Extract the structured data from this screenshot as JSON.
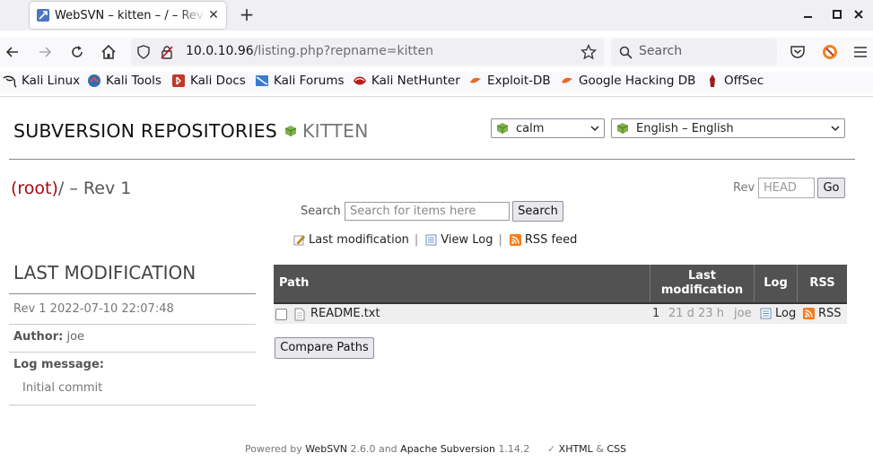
{
  "browser": {
    "tab_title": "WebSVN – kitten – / – Rev 1",
    "url_host": "10.0.10.96",
    "url_path": "/listing.php?repname=kitten",
    "search_placeholder": "Search",
    "bookmarks": [
      "Kali Linux",
      "Kali Tools",
      "Kali Docs",
      "Kali Forums",
      "Kali NetHunter",
      "Exploit-DB",
      "Google Hacking DB",
      "OffSec"
    ]
  },
  "header": {
    "title": "SUBVERSION REPOSITORIES",
    "repo": "KITTEN",
    "template_select": "calm",
    "language_select": "English – English"
  },
  "path_bar": {
    "root": "(root)",
    "path_suffix": "/ – Rev 1",
    "rev_label": "Rev",
    "rev_placeholder": "HEAD",
    "go_label": "Go"
  },
  "search": {
    "label": "Search",
    "placeholder": "Search for items here",
    "button": "Search"
  },
  "actions": {
    "last_modification": "Last modification",
    "view_log": "View Log",
    "rss_feed": "RSS feed",
    "separator": "|"
  },
  "last_mod": {
    "heading": "LAST MODIFICATION",
    "rev_line": "Rev 1 2022-07-10 22:07:48",
    "author_label": "Author:",
    "author": "joe",
    "log_label": "Log message:",
    "log_message": "Initial commit"
  },
  "table": {
    "headers": {
      "path": "Path",
      "last_mod_1": "Last",
      "last_mod_2": "modification",
      "log": "Log",
      "rss": "RSS"
    },
    "rows": [
      {
        "name": "README.txt",
        "rev": "1",
        "age": "21 d 23 h",
        "author": "joe",
        "log": "Log",
        "rss": "RSS"
      }
    ]
  },
  "compare_button": "Compare Paths",
  "footer": {
    "powered_by": "Powered by",
    "websvn": "WebSVN",
    "version_and": "2.6.0 and",
    "svn": "Apache Subversion",
    "svn_version": "1.14.2",
    "check": "✓",
    "xhtml": "XHTML",
    "amp": "&",
    "css": "CSS"
  },
  "colors": {
    "root_link": "#a50c0c",
    "table_header": "#525252",
    "row_bg": "#efefef"
  }
}
